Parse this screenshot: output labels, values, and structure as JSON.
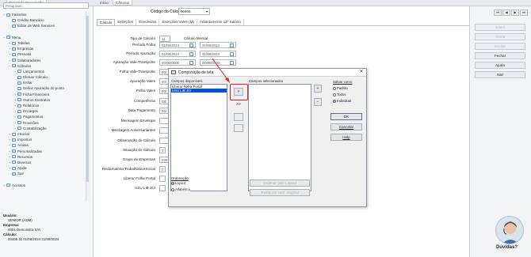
{
  "top_tabs": {
    "left": "Painel de Navegação",
    "mid1": "Início",
    "mid2": "Cálculos"
  },
  "search": {
    "placeholder": "Pesquisar..."
  },
  "tree": [
    {
      "toggle": "−",
      "label": "Favoritos",
      "indent": 0
    },
    {
      "toggle": "",
      "label": "Crédito Bancário",
      "indent": 1
    },
    {
      "toggle": "",
      "label": "Editor de Web Services",
      "indent": 1
    },
    {
      "toggle": "",
      "label": "",
      "indent": 0
    },
    {
      "toggle": "−",
      "label": "Menu",
      "indent": 0
    },
    {
      "toggle": "+",
      "label": "Tabelas",
      "indent": 1
    },
    {
      "toggle": "+",
      "label": "Empresas",
      "indent": 1
    },
    {
      "toggle": "+",
      "label": "Pessoas",
      "indent": 1
    },
    {
      "toggle": "+",
      "label": "Colaboradores",
      "indent": 1
    },
    {
      "toggle": "−",
      "label": "Cálculos",
      "indent": 1
    },
    {
      "toggle": "+",
      "label": "Lançamentos",
      "indent": 2
    },
    {
      "toggle": "",
      "label": "Efetuar Cálculo",
      "indent": 2
    },
    {
      "toggle": "",
      "label": "Enfiar",
      "indent": 2
    },
    {
      "toggle": "",
      "label": "Definir Apuração do ponto",
      "indent": 2
    },
    {
      "toggle": "+",
      "label": "Ficha Financeira",
      "indent": 2
    },
    {
      "toggle": "+",
      "label": "Outros Contratos",
      "indent": 2
    },
    {
      "toggle": "+",
      "label": "Relatórios",
      "indent": 2
    },
    {
      "toggle": "+",
      "label": "Encargos",
      "indent": 2
    },
    {
      "toggle": "+",
      "label": "Pagamentos",
      "indent": 2
    },
    {
      "toggle": "+",
      "label": "Provisões",
      "indent": 2
    },
    {
      "toggle": "+",
      "label": "Contabilização",
      "indent": 2
    },
    {
      "toggle": "+",
      "label": "eSocial",
      "indent": 1
    },
    {
      "toggle": "+",
      "label": "Impostos",
      "indent": 1
    },
    {
      "toggle": "+",
      "label": "Anuais",
      "indent": 1
    },
    {
      "toggle": "+",
      "label": "Personalizadas",
      "indent": 1
    },
    {
      "toggle": "+",
      "label": "Recursos",
      "indent": 1
    },
    {
      "toggle": "+",
      "label": "Diversos",
      "indent": 1
    },
    {
      "toggle": "+",
      "label": "Ajuda",
      "indent": 1
    },
    {
      "toggle": "",
      "label": "Sair",
      "indent": 1
    },
    {
      "toggle": "",
      "label": "",
      "indent": 0
    },
    {
      "toggle": "+",
      "label": "Acessos",
      "indent": 0
    }
  ],
  "footer": {
    "user_label": "Usuário:",
    "user_value": "SENIOR (ADM)",
    "company_label": "Empresa:",
    "company_value": "0001 Demonstra S/A",
    "calc_label": "Cálculo:",
    "calc_value": "00405  11  01/08/2024  31/08/2024"
  },
  "header": {
    "code_label": "Código do Cálculo",
    "code_value": "00405"
  },
  "main_tabs": [
    "Cálculo",
    "Exceções",
    "Envolvidos",
    "Exceções Vales (M)",
    "Adiantamento 13º Salário"
  ],
  "form": {
    "tipo_label": "Tipo de Cálculo",
    "tipo_value": "11",
    "tipo_desc": "Cálculo Mensal",
    "periodo_label": "Período Folha",
    "periodo_start": "01/08/2024",
    "periodo_end": "31/08/2024",
    "apuracao_label": "Período Apuração",
    "apuracao_start": "01/08/2024",
    "apuracao_end": "31/08/2024",
    "vt_label": "Apuração Vale-Transporte",
    "vt_start": "00/00/0000",
    "vt_end": "00/00/0000",
    "fvt_label": "Folha Vale-Transporte",
    "fvt_value": "00/",
    "av_label": "Apuração Vales",
    "av_value": "00/",
    "fv_label": "Folha Vales",
    "fv_value": "00/",
    "comp_label": "Competência",
    "comp_value": "08/",
    "pag_label": "Data Pagamento",
    "pag_value": "06/",
    "me_label": "Mensagem Envelope",
    "me_value": "",
    "ma_label": "Mensagem Aniversariantes",
    "ma_value": "",
    "obs_label": "Observação do Cálculo",
    "obs_value": "",
    "sit_label": "Situação do Cálculo",
    "sit_value": "3",
    "grp_label": "Grupo de Empresas",
    "grp_value": "000",
    "rec_label": "Reclamatória Trabalhista eSocial",
    "rec_value": "0",
    "lib_label": "Liberar Folha Portal",
    "lib_value": "",
    "usu_label": "USU LIB JCI",
    "usu_value": ""
  },
  "toolbar": {
    "b1": "Inserir",
    "b2": "Alterar",
    "b3": "Excluir",
    "b4": "Fechar",
    "b5": "Ajuda",
    "b6": "Sair"
  },
  "nav": [
    "⏮",
    "◀",
    "▶",
    "⏭"
  ],
  "dialog": {
    "title": "Composição de tela",
    "avail_label": "Campos disponíveis",
    "avail_items": [
      "Liberar Folha Portal",
      "USU LIB JCI"
    ],
    "selected_label": "Campos selecionados",
    "save_label": "Salvar como",
    "save_opts": [
      "Padrão",
      "Todos",
      "Individual"
    ],
    "ok": "OK",
    "cancel": "Cancelar",
    "help": "Help",
    "order_label": "Ordenação",
    "order_opts": [
      "Layout",
      "Alfabética"
    ],
    "btn_layout": "Ordenar pelo Layout",
    "btn_restore": "Restaurar conf. original",
    "move_one": ">",
    "move_all": ">>",
    "plus": "+",
    "minus": "−"
  },
  "help_bubble": "Dúvidas?"
}
